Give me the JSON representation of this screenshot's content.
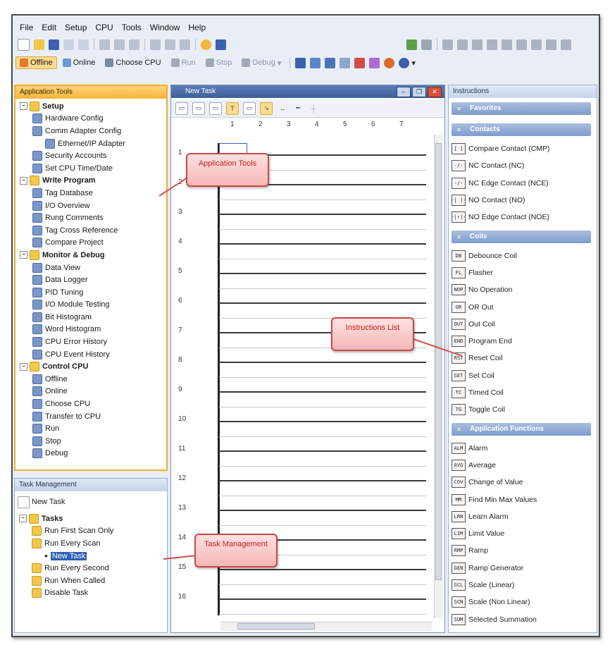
{
  "menubar": [
    "File",
    "Edit",
    "Setup",
    "CPU",
    "Tools",
    "Window",
    "Help"
  ],
  "toolbar2": {
    "buttons": [
      {
        "label": "Offline",
        "icon": "offline-icon"
      },
      {
        "label": "Online",
        "icon": "online-icon"
      },
      {
        "label": "Choose CPU",
        "icon": "choose-cpu-icon"
      },
      {
        "label": "Run",
        "icon": "run-icon"
      },
      {
        "label": "Stop",
        "icon": "stop-icon"
      },
      {
        "label": "Debug",
        "icon": "debug-icon"
      }
    ]
  },
  "app_tools": {
    "title": "Application Tools",
    "items": [
      {
        "label": "Setup",
        "level": 0,
        "group": true,
        "icon": "folder-icon"
      },
      {
        "label": "Hardware Config",
        "level": 1,
        "icon": "hardware-config-icon"
      },
      {
        "label": "Comm Adapter Config",
        "level": 1,
        "icon": "comm-adapter-icon"
      },
      {
        "label": "Ethernet/IP Adapter",
        "level": 2,
        "icon": "ethernet-icon"
      },
      {
        "label": "Security Accounts",
        "level": 1,
        "icon": "key-icon"
      },
      {
        "label": "Set CPU Time/Date",
        "level": 1,
        "icon": "clock-icon"
      },
      {
        "label": "Write Program",
        "level": 0,
        "group": true,
        "icon": "folder-icon"
      },
      {
        "label": "Tag Database",
        "level": 1,
        "icon": "database-icon"
      },
      {
        "label": "I/O Overview",
        "level": 1,
        "icon": "io-icon"
      },
      {
        "label": "Rung Comments",
        "level": 1,
        "icon": "comment-icon"
      },
      {
        "label": "Tag Cross Reference",
        "level": 1,
        "icon": "cross-reference-icon"
      },
      {
        "label": "Compare Project",
        "level": 1,
        "icon": "compare-icon"
      },
      {
        "label": "Monitor & Debug",
        "level": 0,
        "group": true,
        "icon": "folder-icon"
      },
      {
        "label": "Data View",
        "level": 1,
        "icon": "data-view-icon"
      },
      {
        "label": "Data Logger",
        "level": 1,
        "icon": "data-logger-icon"
      },
      {
        "label": "PID Tuning",
        "level": 1,
        "icon": "pid-icon"
      },
      {
        "label": "I/O Module Testing",
        "level": 1,
        "icon": "module-test-icon"
      },
      {
        "label": "Bit Histogram",
        "level": 1,
        "icon": "bit-histogram-icon"
      },
      {
        "label": "Word Histogram",
        "level": 1,
        "icon": "word-histogram-icon"
      },
      {
        "label": "CPU Error History",
        "level": 1,
        "icon": "error-history-icon"
      },
      {
        "label": "CPU Event History",
        "level": 1,
        "icon": "event-history-icon"
      },
      {
        "label": "Control CPU",
        "level": 0,
        "group": true,
        "icon": "folder-icon"
      },
      {
        "label": "Offline",
        "level": 1,
        "icon": "offline-icon"
      },
      {
        "label": "Online",
        "level": 1,
        "icon": "online-icon"
      },
      {
        "label": "Choose CPU",
        "level": 1,
        "icon": "choose-cpu-icon"
      },
      {
        "label": "Transfer to CPU",
        "level": 1,
        "icon": "transfer-icon"
      },
      {
        "label": "Run",
        "level": 1,
        "icon": "run-icon"
      },
      {
        "label": "Stop",
        "level": 1,
        "icon": "stop-icon"
      },
      {
        "label": "Debug",
        "level": 1,
        "icon": "debug-icon"
      }
    ]
  },
  "task_management": {
    "title": "Task Management",
    "new_task": "New Task",
    "items": [
      {
        "label": "Tasks",
        "level": 0,
        "group": true
      },
      {
        "label": "Run First Scan Only",
        "level": 1
      },
      {
        "label": "Run Every Scan",
        "level": 1
      },
      {
        "label": "New Task",
        "level": 2,
        "selected": true
      },
      {
        "label": "Run Every Second",
        "level": 1
      },
      {
        "label": "Run When Called",
        "level": 1
      },
      {
        "label": "Disable Task",
        "level": 1
      }
    ]
  },
  "editor": {
    "title": "New Task",
    "columns": [
      "1",
      "2",
      "3",
      "4",
      "5",
      "6",
      "7"
    ],
    "rungs": [
      "1",
      "2",
      "3",
      "4",
      "5",
      "6",
      "7",
      "8",
      "9",
      "10",
      "11",
      "12",
      "13",
      "14",
      "15",
      "16"
    ]
  },
  "instructions": {
    "title": "Instructions",
    "categories": [
      {
        "name": "Favorites",
        "items": []
      },
      {
        "name": "Contacts",
        "items": [
          {
            "label": "Compare Contact (CMP)",
            "icon": "compare-contact-icon",
            "glyph": "[ ]"
          },
          {
            "label": "NC Contact (NC)",
            "icon": "nc-contact-icon",
            "glyph": "-/-"
          },
          {
            "label": "NC Edge Contact (NCE)",
            "icon": "nc-edge-contact-icon",
            "glyph": "-/-"
          },
          {
            "label": "NO Contact (NO)",
            "icon": "no-contact-icon",
            "glyph": "-| |-"
          },
          {
            "label": "NO Edge Contact (NOE)",
            "icon": "no-edge-contact-icon",
            "glyph": "-|↑|-"
          }
        ]
      },
      {
        "name": "Coils",
        "items": [
          {
            "label": "Debounce Coil",
            "icon": "debounce-coil-icon",
            "glyph": "DB"
          },
          {
            "label": "Flasher",
            "icon": "flasher-icon",
            "glyph": "FL"
          },
          {
            "label": "No Operation",
            "icon": "no-operation-icon",
            "glyph": "NOP"
          },
          {
            "label": "OR Out",
            "icon": "or-out-icon",
            "glyph": "OR"
          },
          {
            "label": "Out Coil",
            "icon": "out-coil-icon",
            "glyph": "OUT"
          },
          {
            "label": "Program End",
            "icon": "program-end-icon",
            "glyph": "END"
          },
          {
            "label": "Reset Coil",
            "icon": "reset-coil-icon",
            "glyph": "RST"
          },
          {
            "label": "Set Coil",
            "icon": "set-coil-icon",
            "glyph": "SET"
          },
          {
            "label": "Timed Coil",
            "icon": "timed-coil-icon",
            "glyph": "TC"
          },
          {
            "label": "Toggle Coil",
            "icon": "toggle-coil-icon",
            "glyph": "TG"
          }
        ]
      },
      {
        "name": "Application Functions",
        "items": [
          {
            "label": "Alarm",
            "icon": "alarm-icon",
            "glyph": "ALM"
          },
          {
            "label": "Average",
            "icon": "average-icon",
            "glyph": "AVG"
          },
          {
            "label": "Change of Value",
            "icon": "change-of-value-icon",
            "glyph": "COV"
          },
          {
            "label": "Find Min Max Values",
            "icon": "find-min-max-icon",
            "glyph": "MM"
          },
          {
            "label": "Learn Alarm",
            "icon": "learn-alarm-icon",
            "glyph": "LRN"
          },
          {
            "label": "Limit Value",
            "icon": "limit-value-icon",
            "glyph": "LIM"
          },
          {
            "label": "Ramp",
            "icon": "ramp-icon",
            "glyph": "RMP"
          },
          {
            "label": "Ramp Generator",
            "icon": "ramp-generator-icon",
            "glyph": "GEN"
          },
          {
            "label": "Scale (Linear)",
            "icon": "scale-linear-icon",
            "glyph": "SCL"
          },
          {
            "label": "Scale (Non Linear)",
            "icon": "scale-nonlinear-icon",
            "glyph": "SCN"
          },
          {
            "label": "Selected Summation",
            "icon": "selected-summation-icon",
            "glyph": "SUM"
          }
        ]
      }
    ]
  },
  "callouts": {
    "app_tools": "Application Tools",
    "instructions": "Instructions List",
    "task_mgmt": "Task Management"
  },
  "colors": {
    "accent_orange": "#f5b43a",
    "title_blue": "#3d5f9a",
    "callout_red": "#c22020"
  }
}
